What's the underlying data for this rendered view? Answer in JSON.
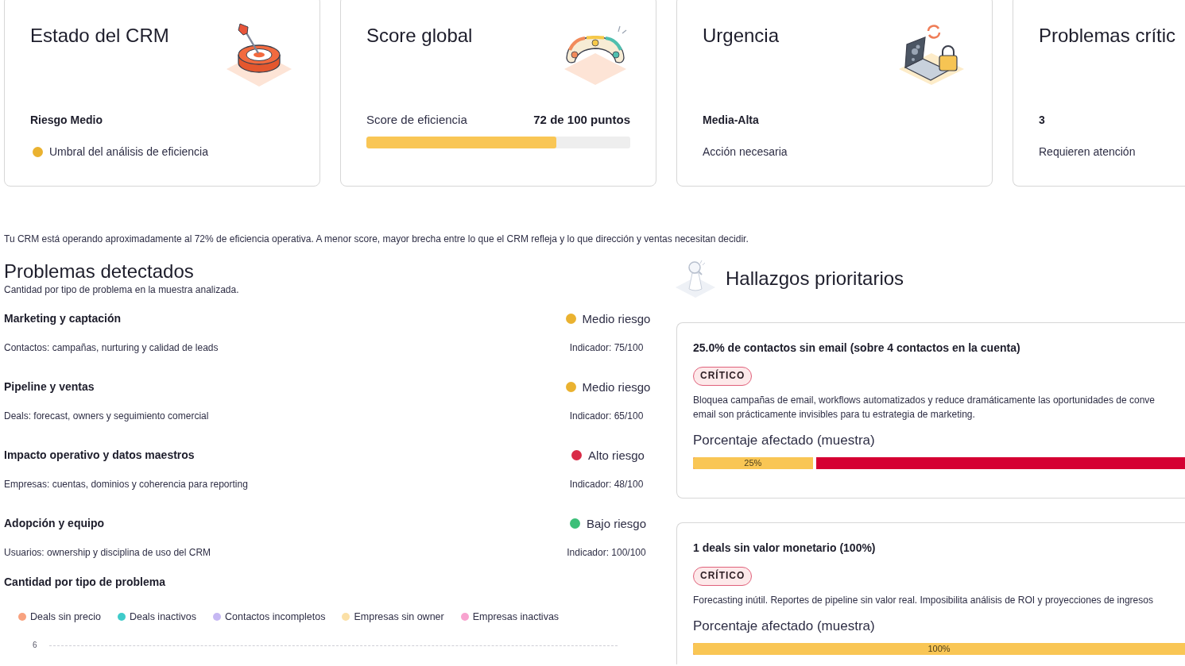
{
  "summary_cards": [
    {
      "kind": "status",
      "title": "Estado del CRM",
      "value": "Riesgo Medio",
      "note": "Umbral del análisis de eficiencia",
      "color": "#eab230"
    },
    {
      "kind": "score",
      "title": "Score global",
      "label": "Score de eficiencia",
      "value": "72 de 100 puntos",
      "level": 0.72
    },
    {
      "kind": "status",
      "title": "Urgencia",
      "value": "Media-Alta",
      "note": "Acción necesaria"
    },
    {
      "kind": "status",
      "title": "Problemas crític",
      "value": "3",
      "note": "Requieren atención"
    }
  ],
  "summary_text": "Tu CRM está operando aproximadamente al 72% de eficiencia operativa. A menor score, mayor brecha entre lo que el CRM refleja y lo que dirección y ventas necesitan decidir.",
  "problems": {
    "title": "Problemas detectados",
    "subtitle": "Cantidad por tipo de problema en la muestra analizada.",
    "rows": [
      {
        "title": "Marketing y captación",
        "risk": "Medio riesgo",
        "color": "#eab230",
        "description": "Contactos: campañas, nurturing y calidad de leads",
        "indicator": "Indicador: 75/100"
      },
      {
        "title": "Pipeline y ventas",
        "risk": "Medio riesgo",
        "color": "#eab230",
        "description": "Deals: forecast, owners y seguimiento comercial",
        "indicator": "Indicador: 65/100"
      },
      {
        "title": "Impacto operativo y datos maestros",
        "risk": "Alto riesgo",
        "color": "#d92b47",
        "description": "Empresas: cuentas, dominios y coherencia para reporting",
        "indicator": "Indicador: 48/100"
      },
      {
        "title": "Adopción y equipo",
        "risk": "Bajo riesgo",
        "color": "#3cbf78",
        "description": "Usuarios: ownership y disciplina de uso del CRM",
        "indicator": "Indicador: 100/100"
      }
    ]
  },
  "chart": {
    "title": "Cantidad por tipo de problema",
    "legend": [
      {
        "label": "Deals sin precio",
        "color": "#f8a27f"
      },
      {
        "label": "Deals inactivos",
        "color": "#3fcbca"
      },
      {
        "label": "Contactos incompletos",
        "color": "#c6b8f3"
      },
      {
        "label": "Empresas sin owner",
        "color": "#fbe0a6"
      },
      {
        "label": "Empresas inactivas",
        "color": "#f8a3cf"
      }
    ],
    "y_tick_labels": [
      "6"
    ]
  },
  "findings": {
    "title": "Hallazgos prioritarios",
    "items": [
      {
        "title": "25.0% de contactos sin email (sobre 4 contactos en la cuenta)",
        "severity": "CRÍTICO",
        "description_lines": [
          "Bloquea campañas de email, workflows automatizados y reduce dramáticamente las oportunidades de conve",
          "email son prácticamente invisibles para tu estrategia de marketing."
        ],
        "progress_label": "Porcentaje afectado (muestra)",
        "level": 0.25,
        "percent": "25%"
      },
      {
        "title": "1 deals sin valor monetario (100%)",
        "severity": "CRÍTICO",
        "description_lines": [
          "Forecasting inútil. Reportes de pipeline sin valor real. Imposibilita análisis de ROI y proyecciones de ingresos"
        ],
        "progress_label": "Porcentaje afectado (muestra)",
        "level": 1,
        "percent": "100%"
      }
    ]
  }
}
